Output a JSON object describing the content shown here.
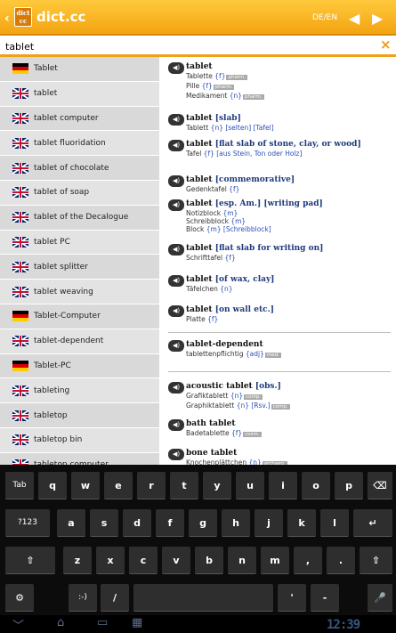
{
  "header": {
    "title": "dict.cc",
    "logo_text": "dict cc",
    "lang_pair": "DE/EN",
    "back": "‹",
    "prev": "◀",
    "next": "▶"
  },
  "search": {
    "value": "tablet",
    "clear": "×"
  },
  "suggestions": [
    {
      "flag": "de",
      "text": "Tablet"
    },
    {
      "flag": "uk",
      "text": "tablet"
    },
    {
      "flag": "uk",
      "text": "tablet computer"
    },
    {
      "flag": "uk",
      "text": "tablet fluoridation"
    },
    {
      "flag": "uk",
      "text": "tablet of chocolate"
    },
    {
      "flag": "uk",
      "text": "tablet of soap"
    },
    {
      "flag": "uk",
      "text": "tablet of the Decalogue"
    },
    {
      "flag": "uk",
      "text": "tablet PC"
    },
    {
      "flag": "uk",
      "text": "tablet splitter"
    },
    {
      "flag": "uk",
      "text": "tablet weaving"
    },
    {
      "flag": "de",
      "text": "Tablet-Computer"
    },
    {
      "flag": "uk",
      "text": "tablet-dependent"
    },
    {
      "flag": "de",
      "text": "Tablet-PC"
    },
    {
      "flag": "uk",
      "text": "tableting"
    },
    {
      "flag": "uk",
      "text": "tabletop"
    },
    {
      "flag": "uk",
      "text": "tabletop bin"
    },
    {
      "flag": "uk",
      "text": "tabletop computer"
    }
  ],
  "entries": [
    {
      "head": "tablet",
      "q": "",
      "lines": [
        {
          "w": "Tablette",
          "g": "{f}",
          "tag": "pharm."
        },
        {
          "w": "Pille",
          "g": "{f}",
          "tag": "pharm."
        },
        {
          "w": "Medikament",
          "g": "{n}",
          "tag": "pharm."
        }
      ]
    },
    {
      "head": "tablet",
      "q": "[slab]",
      "lines": [
        {
          "w": "Tablett",
          "g": "{n} [selten] [Tafel]",
          "tag": ""
        }
      ]
    },
    {
      "head": "tablet",
      "q": "[flat slab of stone, clay, or wood]",
      "lines": [
        {
          "w": "Tafel",
          "g": "{f} [aus Stein, Ton oder Holz]",
          "tag": ""
        }
      ]
    },
    {
      "head": "tablet",
      "q": "[commemorative]",
      "lines": [
        {
          "w": "Gedenktafel",
          "g": "{f}",
          "tag": ""
        }
      ]
    },
    {
      "head": "tablet",
      "q": "[esp. Am.] [writing pad]",
      "lines": [
        {
          "w": "Notizblock",
          "g": "{m}",
          "tag": ""
        },
        {
          "w": "Schreibblock",
          "g": "{m}",
          "tag": ""
        },
        {
          "w": "Block",
          "g": "{m} [Schreibblock]",
          "tag": ""
        }
      ]
    },
    {
      "head": "tablet",
      "q": "[flat slab for writing on]",
      "lines": [
        {
          "w": "Schrifttafel",
          "g": "{f}",
          "tag": ""
        }
      ]
    },
    {
      "head": "tablet",
      "q": "[of wax, clay]",
      "lines": [
        {
          "w": "Täfelchen",
          "g": "{n}",
          "tag": ""
        }
      ]
    },
    {
      "head": "tablet",
      "q": "[on wall etc.]",
      "lines": [
        {
          "w": "Platte",
          "g": "{f}",
          "tag": ""
        }
      ]
    },
    {
      "head": "tablet-dependent",
      "q": "",
      "lines": [
        {
          "w": "tablettenpflichtig",
          "g": "{adj}",
          "tag": "med."
        }
      ]
    },
    {
      "head": "acoustic tablet",
      "q": "[obs.]",
      "lines": [
        {
          "w": "Grafiktablett",
          "g": "{n}",
          "tag": "comp."
        },
        {
          "w": "Graphiktablett",
          "g": "{n} [Rsv.]",
          "tag": "comp."
        }
      ]
    },
    {
      "head": "bath tablet",
      "q": "",
      "lines": [
        {
          "w": "Badetablette",
          "g": "{f}",
          "tag": "cosm."
        }
      ]
    },
    {
      "head": "bone tablet",
      "q": "",
      "lines": [
        {
          "w": "Knochenplättchen",
          "g": "{n}",
          "tag": "archaeo."
        }
      ]
    }
  ],
  "keyboard": {
    "row1": [
      "Tab",
      "q",
      "w",
      "e",
      "r",
      "t",
      "y",
      "u",
      "i",
      "o",
      "p",
      "⌫"
    ],
    "row2": [
      "?123",
      "a",
      "s",
      "d",
      "f",
      "g",
      "h",
      "j",
      "k",
      "l",
      "↵"
    ],
    "row3": [
      "⇧",
      "z",
      "x",
      "c",
      "v",
      "b",
      "n",
      "m",
      ",",
      ".",
      "⇧"
    ],
    "row4": [
      "⚙",
      ":-)",
      "/",
      " ",
      "'",
      "-",
      "🎤"
    ]
  },
  "navbar": {
    "back": "﹀",
    "home": "⌂",
    "recent": "▭",
    "grid": "▦",
    "clock": "12:39"
  }
}
